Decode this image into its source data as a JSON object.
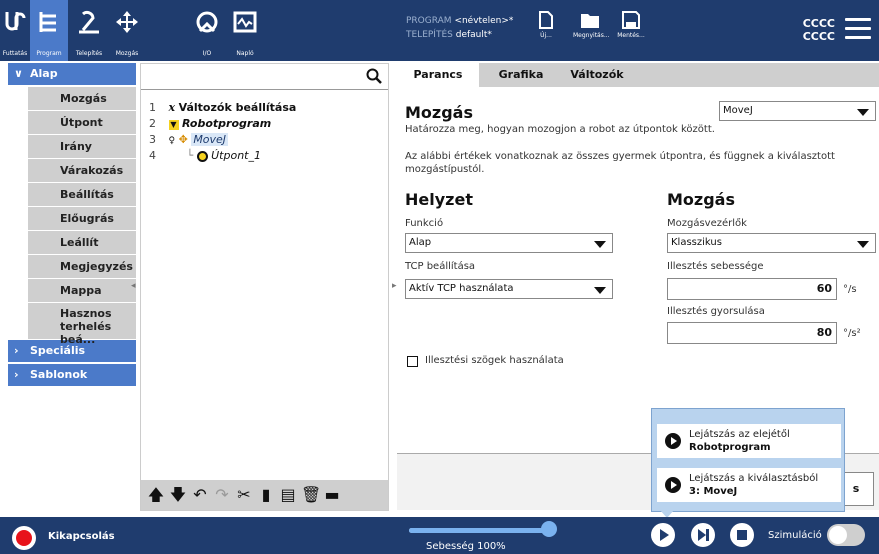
{
  "topnav": {
    "items": [
      {
        "label": "Futtatás",
        "icon": "ur-logo-icon"
      },
      {
        "label": "Program",
        "icon": "program-icon"
      },
      {
        "label": "Telepítés",
        "icon": "installation-icon"
      },
      {
        "label": "Mozgás",
        "icon": "move-icon"
      },
      {
        "label": "I/O",
        "icon": "io-icon"
      },
      {
        "label": "Napló",
        "icon": "log-icon"
      }
    ],
    "active_index": 1
  },
  "program_info": {
    "program_label": "PROGRAM",
    "program_value": "<névtelen>*",
    "install_label": "TELEPÍTÉS",
    "install_value": "default*"
  },
  "file_actions": {
    "new_label": "Új...",
    "open_label": "Megnyitás...",
    "save_label": "Mentés..."
  },
  "header_right": {
    "line1": "CCCC",
    "line2": "CCCC"
  },
  "sidebar": {
    "basic_label": "Alap",
    "items": [
      "Mozgás",
      "Útpont",
      "Irány",
      "Várakozás",
      "Beállítás",
      "Előugrás",
      "Leállít",
      "Megjegyzés",
      "Mappa",
      "Hasznos terhelés beá..."
    ],
    "special_label": "Speciális",
    "templates_label": "Sablonok"
  },
  "tree": {
    "search_placeholder": "",
    "rows": [
      {
        "num": "1",
        "text": "Változók beállítása"
      },
      {
        "num": "2",
        "text": "Robotprogram"
      },
      {
        "num": "3",
        "text": "MoveJ"
      },
      {
        "num": "4",
        "text": "Útpont_1"
      }
    ]
  },
  "tabs": [
    "Parancs",
    "Grafika",
    "Változók"
  ],
  "command": {
    "title": "Mozgás",
    "move_type": "MoveJ",
    "desc1": "Határozza meg, hogyan mozogjon a robot az útpontok között.",
    "desc2": "Az alábbi értékek vonatkoznak az összes gyermek útpontra, és függnek a kiválasztott mozgástípustól.",
    "position_title": "Helyzet",
    "function_label": "Funkció",
    "function_value": "Alap",
    "tcp_label": "TCP beállítása",
    "tcp_value": "Aktív TCP használata",
    "motion_title": "Mozgás",
    "controllers_label": "Mozgásvezérlők",
    "controllers_value": "Klasszikus",
    "speed_label": "Illesztés sebessége",
    "speed_value": "60",
    "speed_unit": "°/s",
    "accel_label": "Illesztés gyorsulása",
    "accel_value": "80",
    "accel_unit": "°/s²",
    "joint_angles_label": "Illesztési szögek használata"
  },
  "play_popup": {
    "item1_line1": "Lejátszás az elejétől",
    "item1_line2": "Robotprogram",
    "item2_line1": "Lejátszás a kiválasztásból",
    "item2_line2": "3: MoveJ",
    "partial_button": "s"
  },
  "bottombar": {
    "power_label": "Kikapcsolás",
    "speed_label": "Sebesség 100%",
    "speed_fraction": 1.0,
    "sim_label": "Szimuláció"
  },
  "colors": {
    "topbar": "#1f3c6e",
    "accent": "#4b7ac9",
    "power": "#e8131b"
  }
}
